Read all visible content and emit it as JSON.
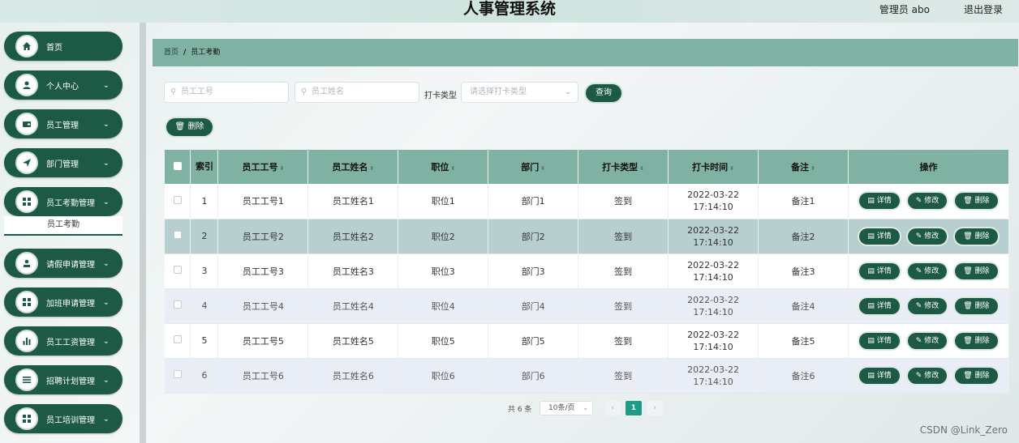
{
  "header": {
    "title": "人事管理系统",
    "user": "管理员 abo",
    "logout": "退出登录"
  },
  "sidebar": {
    "items": [
      {
        "label": "首页",
        "icon": "home-icon",
        "has_children": false
      },
      {
        "label": "个人中心",
        "icon": "person-icon",
        "has_children": true
      },
      {
        "label": "员工管理",
        "icon": "wallet-icon",
        "has_children": true
      },
      {
        "label": "部门管理",
        "icon": "send-icon",
        "has_children": true
      },
      {
        "label": "员工考勤管理",
        "icon": "grid-icon",
        "has_children": true
      },
      {
        "label": "请假申请管理",
        "icon": "user-card-icon",
        "has_children": true
      },
      {
        "label": "加班申请管理",
        "icon": "grid-icon",
        "has_children": true
      },
      {
        "label": "员工工资管理",
        "icon": "bar-chart-icon",
        "has_children": true
      },
      {
        "label": "招聘计划管理",
        "icon": "list-icon",
        "has_children": true
      },
      {
        "label": "员工培训管理",
        "icon": "grid-icon",
        "has_children": true
      }
    ],
    "active_sub": "员工考勤"
  },
  "breadcrumb": {
    "home": "首页",
    "separator": "/",
    "current": "员工考勤"
  },
  "filters": {
    "emp_no_placeholder": "员工工号",
    "emp_name_placeholder": "员工姓名",
    "punch_type_label": "打卡类型",
    "punch_type_placeholder": "请选择打卡类型",
    "query_button": "查询",
    "delete_button": "删除"
  },
  "table": {
    "headers": [
      "索引",
      "员工工号",
      "员工姓名",
      "职位",
      "部门",
      "打卡类型",
      "打卡时间",
      "备注",
      "操作"
    ],
    "rows": [
      {
        "index": "1",
        "emp_no": "员工工号1",
        "emp_name": "员工姓名1",
        "position": "职位1",
        "dept": "部门1",
        "type": "签到",
        "time": "2022-03-22 17:14:10",
        "note": "备注1"
      },
      {
        "index": "2",
        "emp_no": "员工工号2",
        "emp_name": "员工姓名2",
        "position": "职位2",
        "dept": "部门2",
        "type": "签到",
        "time": "2022-03-22 17:14:10",
        "note": "备注2"
      },
      {
        "index": "3",
        "emp_no": "员工工号3",
        "emp_name": "员工姓名3",
        "position": "职位3",
        "dept": "部门3",
        "type": "签到",
        "time": "2022-03-22 17:14:10",
        "note": "备注3"
      },
      {
        "index": "4",
        "emp_no": "员工工号4",
        "emp_name": "员工姓名4",
        "position": "职位4",
        "dept": "部门4",
        "type": "签到",
        "time": "2022-03-22 17:14:10",
        "note": "备注4"
      },
      {
        "index": "5",
        "emp_no": "员工工号5",
        "emp_name": "员工姓名5",
        "position": "职位5",
        "dept": "部门5",
        "type": "签到",
        "time": "2022-03-22 17:14:10",
        "note": "备注5"
      },
      {
        "index": "6",
        "emp_no": "员工工号6",
        "emp_name": "员工姓名6",
        "position": "职位6",
        "dept": "部门6",
        "type": "签到",
        "time": "2022-03-22 17:14:10",
        "note": "备注6"
      }
    ],
    "actions": {
      "detail": "详情",
      "edit": "修改",
      "delete": "删除"
    }
  },
  "pagination": {
    "total": "共 6 条",
    "page_size": "10条/页",
    "prev": "‹",
    "current": "1",
    "next": "›"
  },
  "watermark": "CSDN @Link_Zero",
  "colors": {
    "primary": "#1c5a45",
    "header_teal": "#7fb2a3",
    "page_active": "#1d9b84"
  }
}
